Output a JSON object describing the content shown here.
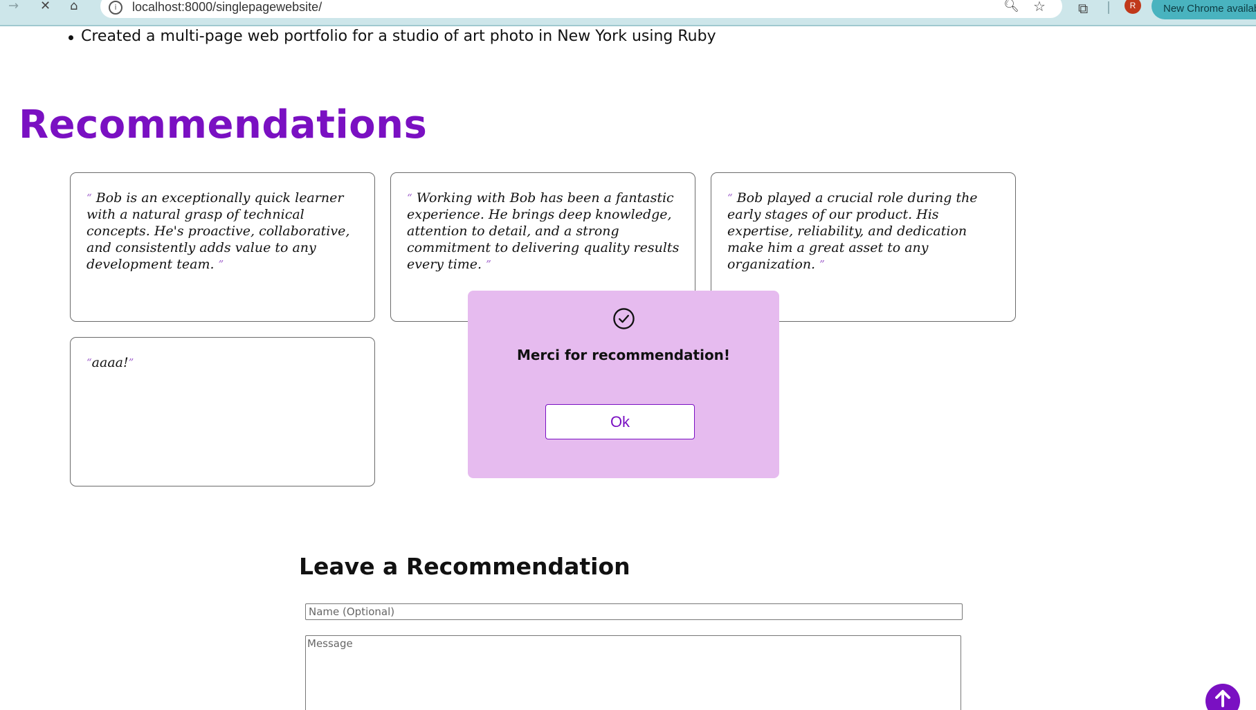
{
  "browser": {
    "url": "localhost:8000/singlepagewebsite/",
    "profile_initial": "R",
    "update_label": "New Chrome available",
    "icons": [
      "forward-icon",
      "stop-icon",
      "home-icon",
      "site-info-icon",
      "zoom-icon",
      "bookmark-star-icon",
      "extensions-icon"
    ]
  },
  "page": {
    "bullet_text": "Created a multi-page web portfolio for a studio of art photo in New York using Ruby",
    "recommendations_title": "Recommendations",
    "recommendations": [
      {
        "text": "Bob is an exceptionally quick learner with a natural grasp of technical concepts. He's proactive, collaborative, and consistently adds value to any development team."
      },
      {
        "text": "Working with Bob has been a fantastic experience. He brings deep knowledge, attention to detail, and a strong commitment to delivering quality results every time."
      },
      {
        "text": "Bob played a crucial role during the early stages of our product. His expertise, reliability, and dedication make him a great asset to any organization."
      },
      {
        "text": "aaaa!"
      }
    ],
    "open_quote": "“",
    "close_quote": "”"
  },
  "modal": {
    "message": "Merci for recommendation!",
    "ok_label": "Ok",
    "icon": "check-circle-icon"
  },
  "form": {
    "title": "Leave a Recommendation",
    "name_placeholder": "Name (Optional)",
    "message_placeholder": "Message"
  },
  "colors": {
    "accent": "#7a10c2",
    "modal_bg": "#e6bbef",
    "chrome_bg": "#cde6ea"
  }
}
